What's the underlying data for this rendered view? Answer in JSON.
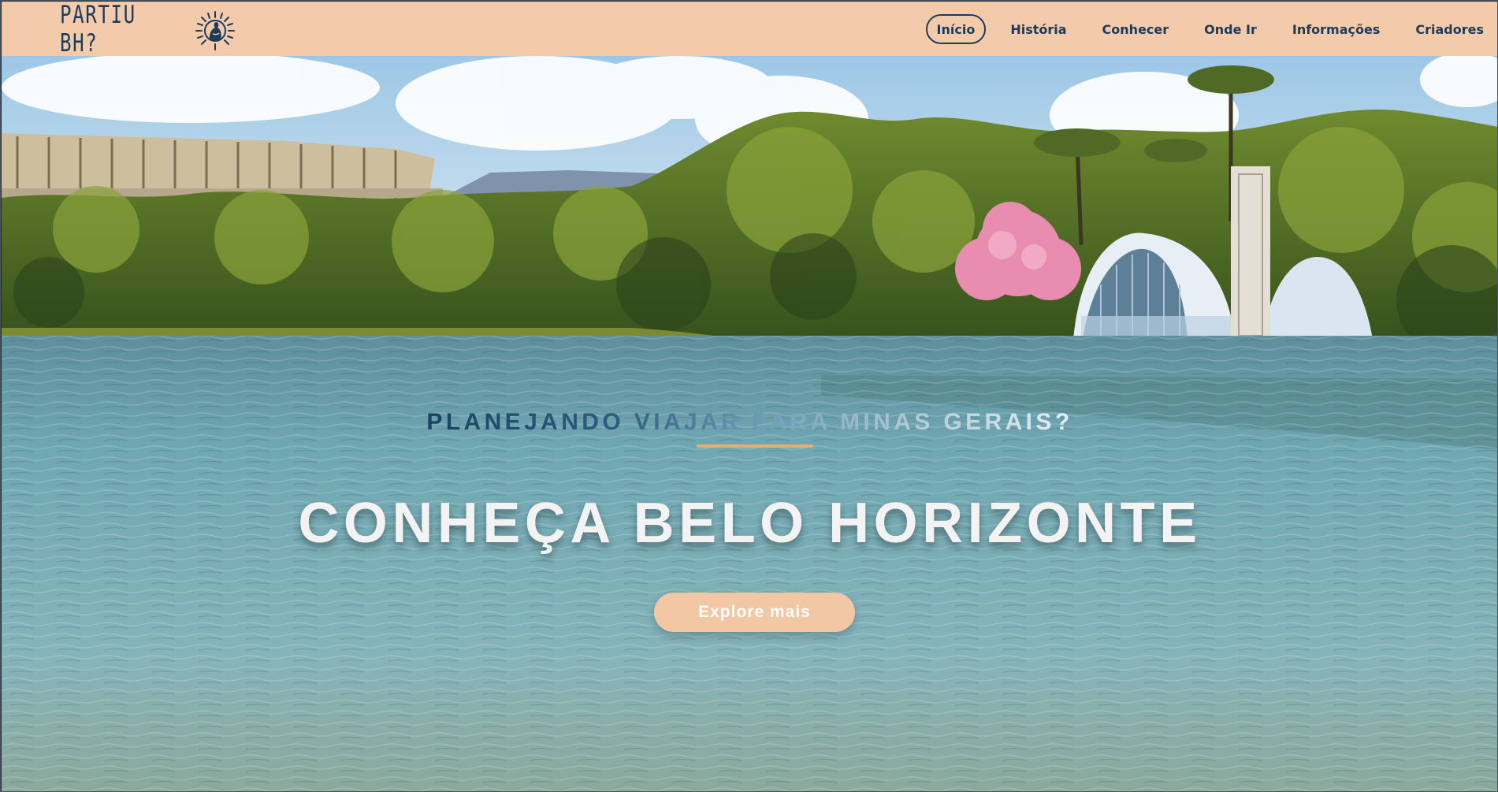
{
  "brand": {
    "name": "PARTIU BH?",
    "logo_icon": "sun-statue-logo-icon"
  },
  "nav": {
    "items": [
      {
        "label": "Início",
        "active": true
      },
      {
        "label": "História",
        "active": false
      },
      {
        "label": "Conhecer",
        "active": false
      },
      {
        "label": "Onde Ir",
        "active": false
      },
      {
        "label": "Informações",
        "active": false
      },
      {
        "label": "Criadores",
        "active": false
      }
    ]
  },
  "hero": {
    "subtitle": "PLANEJANDO VIAJAR PARA MINAS GERAIS?",
    "headline": "CONHEÇA BELO HORIZONTE",
    "cta_label": "Explore mais"
  },
  "colors": {
    "navbar_bg": "#f4cbaa",
    "nav_text": "#1d3a5b",
    "accent_underline": "#e9ad74",
    "cta_bg": "#f2c7a4",
    "headline": "#f3f3f3"
  }
}
